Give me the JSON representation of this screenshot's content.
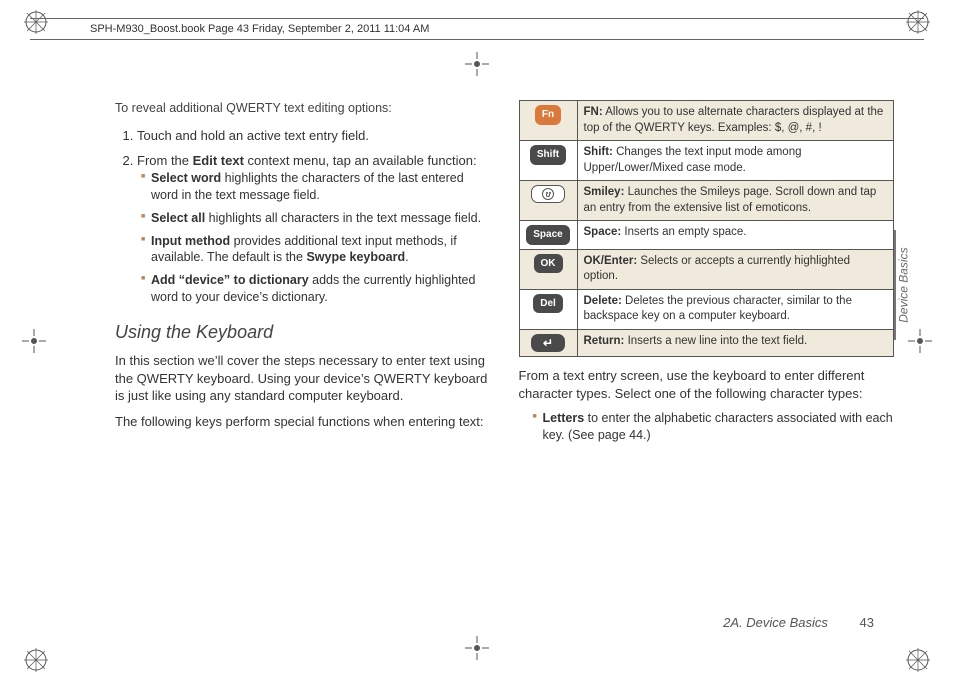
{
  "header": "SPH-M930_Boost.book  Page 43  Friday, September 2, 2011  11:04 AM",
  "left": {
    "intro": "To reveal additional QWERTY text editing options:",
    "steps": [
      {
        "text": "Touch and hold an active text entry field."
      },
      {
        "prefix": "From the ",
        "bold": "Edit text",
        "suffix": " context menu, tap an available function:",
        "items": [
          {
            "b": "Select word",
            "t": " highlights the characters of the last entered word in the text message field."
          },
          {
            "b": "Select all",
            "t": " highlights all characters in the text message field."
          },
          {
            "b": "Input method",
            "t": " provides additional text input methods, if available. The default is the ",
            "b2": "Swype keyboard",
            "t2": "."
          },
          {
            "b": "Add “device” to dictionary",
            "t": " adds the currently highlighted word to your device’s dictionary."
          }
        ]
      }
    ],
    "heading": "Using the Keyboard",
    "para1": "In this section we’ll cover the steps necessary to enter text using the QWERTY keyboard. Using your device’s QWERTY keyboard is just like using any standard computer keyboard.",
    "para2": "The following keys perform special functions when entering text:"
  },
  "right": {
    "rows": [
      {
        "icon_label": "Fn",
        "icon_style": "orange",
        "name": "FN:",
        "desc": " Allows you to use alternate characters displayed at the top of the QWERTY keys. Examples: $, @, #, !"
      },
      {
        "icon_label": "Shift",
        "icon_style": "dark",
        "name": "Shift:",
        "desc": " Changes the text input mode among Upper/Lower/Mixed case mode."
      },
      {
        "icon_label": "",
        "icon_style": "smiley",
        "name": "Smiley:",
        "desc": " Launches the Smileys page. Scroll down and tap an entry from the extensive list of emoticons."
      },
      {
        "icon_label": "Space",
        "icon_style": "dark",
        "name": "Space:",
        "desc": " Inserts an empty space."
      },
      {
        "icon_label": "OK",
        "icon_style": "dark",
        "name": "OK/Enter:",
        "desc": " Selects or accepts a currently highlighted option."
      },
      {
        "icon_label": "Del",
        "icon_style": "dark",
        "name": "Delete:",
        "desc": " Deletes the previous character, similar to the backspace key on a computer keyboard."
      },
      {
        "icon_label": "",
        "icon_style": "return",
        "name": "Return:",
        "desc": " Inserts a new line into the text field."
      }
    ],
    "after_para": "From a text entry screen, use the keyboard to enter different character types. Select one of the following character types:",
    "bullet": {
      "b": "Letters",
      "t": " to enter the alphabetic characters associated with each key. (See page 44.)"
    }
  },
  "side_tab": "Device Basics",
  "footer_section": "2A. Device Basics",
  "footer_page": "43"
}
